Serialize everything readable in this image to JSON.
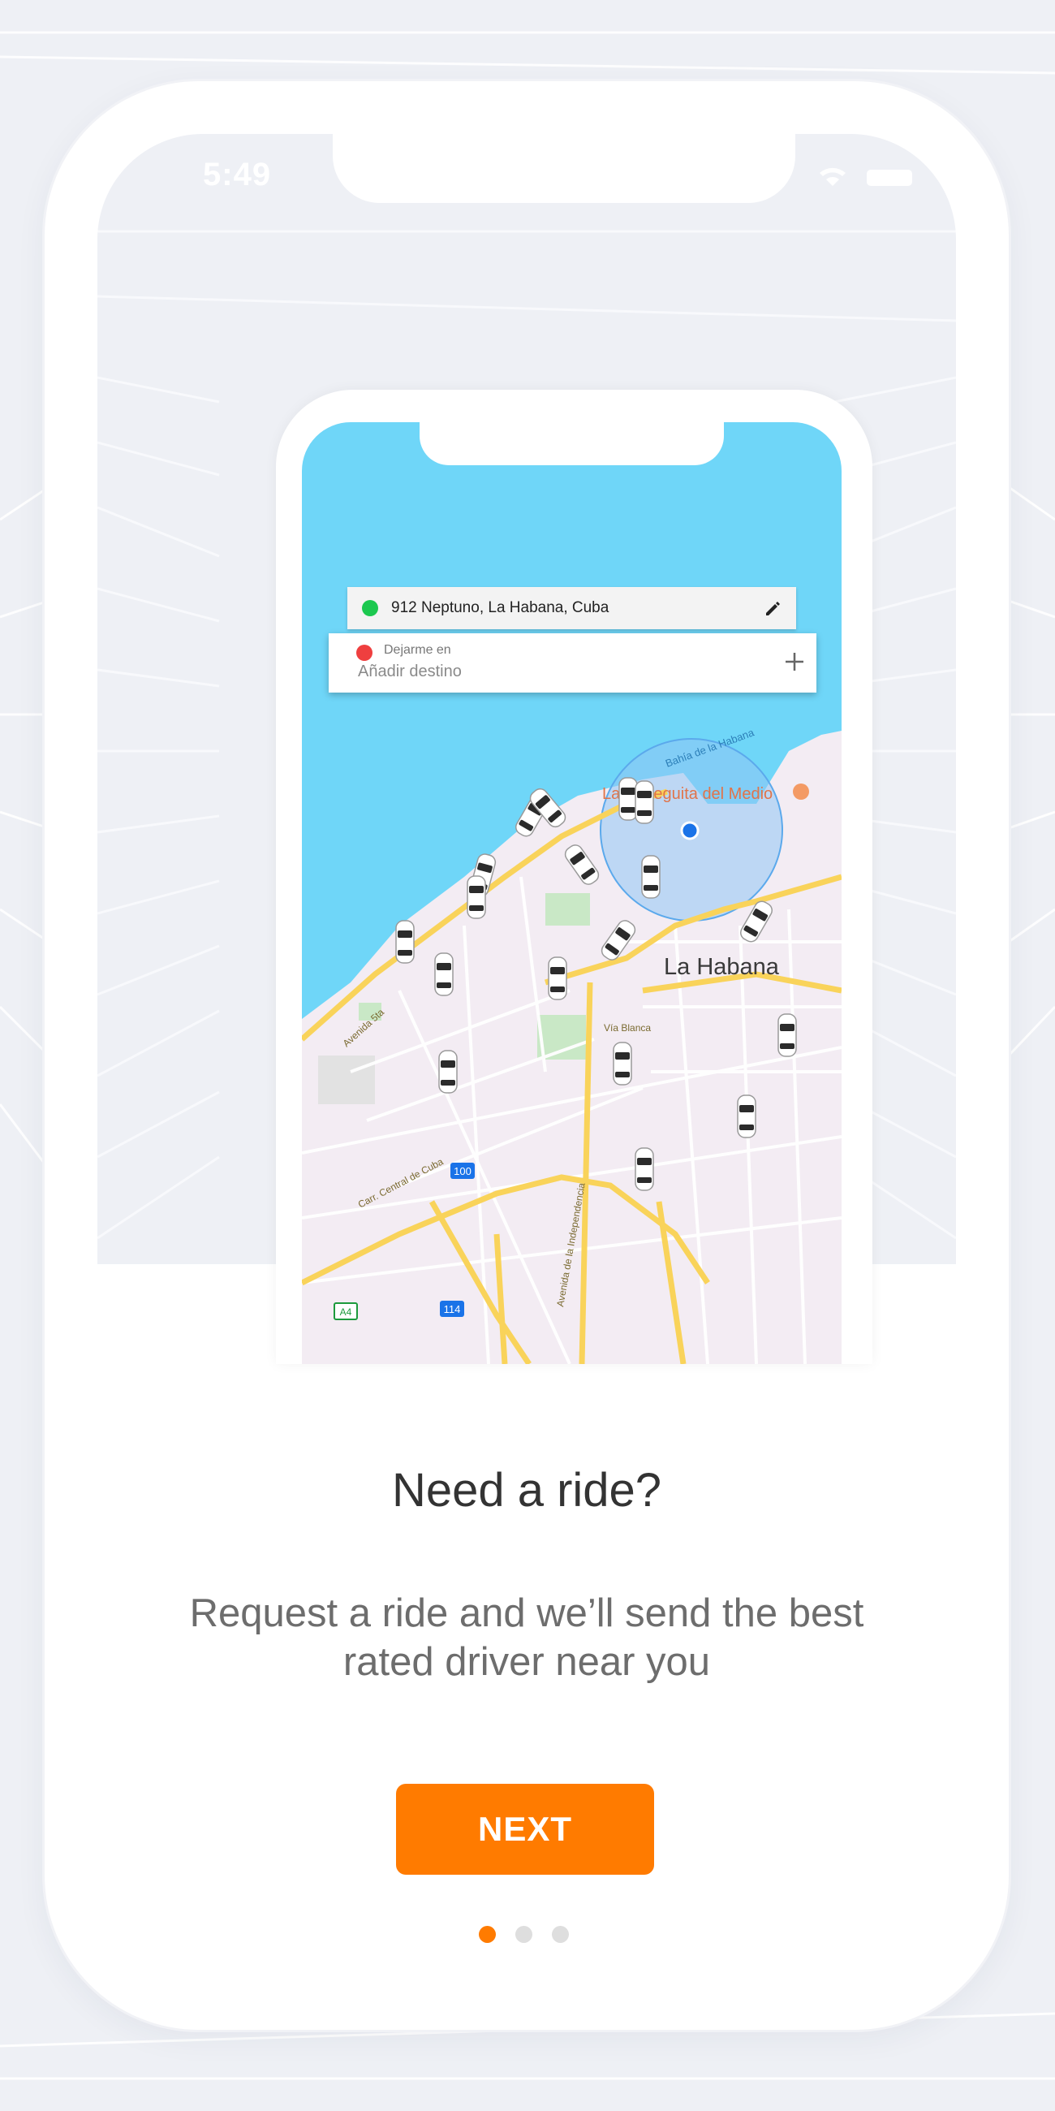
{
  "status_bar": {
    "time": "5:49"
  },
  "map": {
    "pickup_address": "912 Neptuno, La Habana, Cuba",
    "destination_label": "Dejarme en",
    "destination_placeholder": "Añadir destino",
    "labels": {
      "city": "La Habana",
      "bay": "Bahía de la Habana",
      "poi": "La Bodeguita del Medio",
      "road_1": "Avenida 5ta",
      "road_2": "Vía Blanca",
      "road_3": "Carr. Central de Cuba",
      "road_4": "Avenida de la Independencia",
      "shield_1": "100",
      "shield_2": "114",
      "shield_3": "A4"
    },
    "icons": {
      "pickup_dot": "green-dot-icon",
      "destination_dot": "red-dot-icon",
      "edit": "pencil-icon",
      "add": "plus-icon",
      "location": "blue-location-dot-icon",
      "car": "car-top-view-icon"
    }
  },
  "onboarding": {
    "title": "Need a ride?",
    "subtitle": "Request a ride and we’ll send the best rated driver near you",
    "next_label": "NEXT",
    "page_count": 3,
    "current_page": 1
  },
  "colors": {
    "accent": "#ff7b00",
    "water": "#6fd6f8",
    "land": "#f3ecf3",
    "road": "#f9d35a",
    "pickup": "#1cc84f",
    "destination": "#ef3f3f",
    "location": "#1a73e8"
  }
}
